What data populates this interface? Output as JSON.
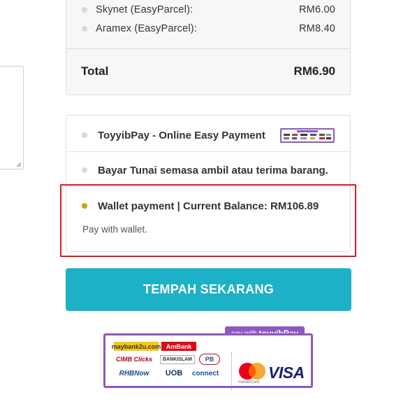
{
  "shipping": {
    "options": [
      {
        "name": "Skynet (EasyParcel):",
        "price": "RM6.00"
      },
      {
        "name": "Aramex (EasyParcel):",
        "price": "RM8.40"
      }
    ],
    "total_label": "Total",
    "total_value": "RM6.90"
  },
  "payment": {
    "methods": [
      {
        "label": "ToyyibPay - Online Easy Payment",
        "selected": false
      },
      {
        "label": "Bayar Tunai semasa ambil atau terima barang.",
        "selected": false
      },
      {
        "label": "Wallet payment | Current Balance: RM106.89",
        "selected": true
      }
    ],
    "selected_description": "Pay with wallet.",
    "selected_radio_color": "#d4a20f",
    "highlight_color": "#e01b1b"
  },
  "place_order": {
    "label": "TEMPAH SEKARANG",
    "color": "#1cb1c6"
  },
  "banner": {
    "tag_prefix": "pay with",
    "tag_brand": "toyyibPay",
    "banks": [
      "maybank2u.com",
      "AmBank",
      "CIMB Clicks",
      "BANKISLAM",
      "PB",
      "RHBNow",
      "UOB",
      "connect"
    ],
    "cards": [
      "mastercard",
      "VISA"
    ],
    "frame_color": "#8e58bf"
  }
}
